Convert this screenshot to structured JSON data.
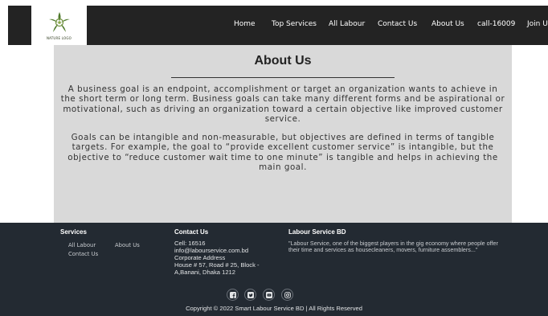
{
  "header": {
    "logo_caption": "NATURE LOGO",
    "nav": [
      {
        "label": "Home"
      },
      {
        "label": "Top Services"
      },
      {
        "label": "All Labour"
      },
      {
        "label": "Contact Us"
      },
      {
        "label": "About Us"
      },
      {
        "label": "call-16009"
      },
      {
        "label": "Join Us"
      }
    ]
  },
  "main": {
    "title": "About Us",
    "paragraphs": [
      "A business goal is an endpoint, accomplishment or target an organization wants to achieve in the short term or long term. Business goals can take many different forms and be aspirational or motivational, such as driving an organization toward a certain objective like improved customer service.",
      "Goals can be intangible and non-measurable, but objectives are defined in terms of tangible targets. For example, the goal to “provide excellent customer service” is intangible, but the objective to “reduce customer wait time to one minute” is tangible and helps in achieving the main goal."
    ]
  },
  "footer": {
    "services": {
      "heading": "Services",
      "links": [
        "All Labour",
        "About Us",
        "Contact Us"
      ]
    },
    "contact": {
      "heading": "Contact Us",
      "cell": "Cell: 16516",
      "email": "info@labourservice.com.bd",
      "address_label": "Corporate Address",
      "address_line1": "House # 57, Road # 25, Block -",
      "address_line2": "A,Banani, Dhaka 1212"
    },
    "about": {
      "heading": "Labour Service BD",
      "quote": "\"Labour Service, one of the biggest players in the gig economy where people offer their time and services as housecleaners, movers, furniture assemblers...\""
    },
    "social_icons": [
      "facebook-icon",
      "twitter-icon",
      "youtube-icon",
      "instagram-icon"
    ],
    "copyright": "Copyright © 2022 Smart Labour Service BD | All Rights Reserved"
  },
  "colors": {
    "header_bg": "#232323",
    "content_bg": "#d9d9d9",
    "footer_bg": "#232a32",
    "logo_green": "#4f7a2c"
  }
}
